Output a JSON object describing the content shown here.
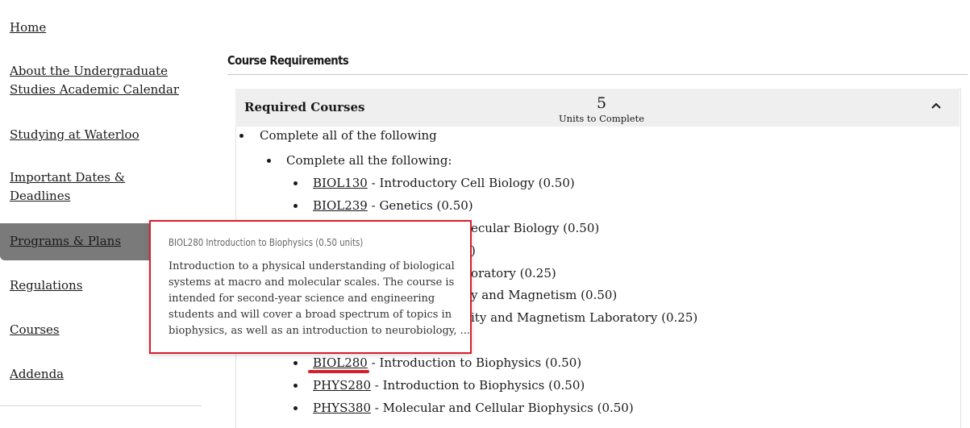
{
  "sidebar": {
    "items": [
      {
        "line1": "Home",
        "line2": ""
      },
      {
        "line1": "About the Undergraduate",
        "line2": "Studies Academic Calendar"
      },
      {
        "line1": "Studying at Waterloo",
        "line2": ""
      },
      {
        "line1": "Important Dates &",
        "line2": "Deadlines"
      },
      {
        "line1": "Programs & Plans",
        "line2": ""
      },
      {
        "line1": "Regulations",
        "line2": ""
      },
      {
        "line1": "Courses",
        "line2": ""
      },
      {
        "line1": "Addenda",
        "line2": ""
      }
    ],
    "active_index": 4
  },
  "main": {
    "section_title": "Course Requirements",
    "requirement": {
      "title": "Required Courses",
      "units": "5",
      "units_label": "Units to Complete"
    },
    "level1": "Complete all of the following",
    "level2": "Complete all the following:",
    "courses": [
      {
        "code": "BIOL130",
        "rest": " - Introductory Cell Biology  (0.50)"
      },
      {
        "code": "BIOL239",
        "rest": " - Genetics  (0.50)"
      },
      {
        "code": "",
        "rest": "ecular Biology  (0.50)"
      },
      {
        "code": "",
        "rest": ")"
      },
      {
        "code": "",
        "rest": "oratory  (0.25)"
      },
      {
        "code": "",
        "rest": "y and Magnetism  (0.50)"
      },
      {
        "code": "",
        "rest": "ity and Magnetism Laboratory  (0.25)"
      },
      {
        "code": "BIOL280",
        "rest": " - Introduction to Biophysics  (0.50)"
      },
      {
        "code": "PHYS280",
        "rest": " - Introduction to Biophysics  (0.50)"
      },
      {
        "code": "PHYS380",
        "rest": " - Molecular and Cellular Biophysics  (0.50)"
      }
    ]
  },
  "tooltip": {
    "title": "BIOL280 Introduction to Biophysics (0.50 units)",
    "lines": [
      "Introduction to a physical understanding of biological",
      "systems at macro and molecular scales. The course is",
      "intended for second-year science and engineering",
      "students and will cover a broad spectrum of topics in",
      "biophysics, as well as an introduction to neurobiology, ..."
    ]
  },
  "colors": {
    "tooltip_border": "#d81e2c",
    "active_nav": "#7a7a7a",
    "header_bg": "#efefef"
  },
  "icons": {
    "collapse": "chevron-up-icon"
  }
}
